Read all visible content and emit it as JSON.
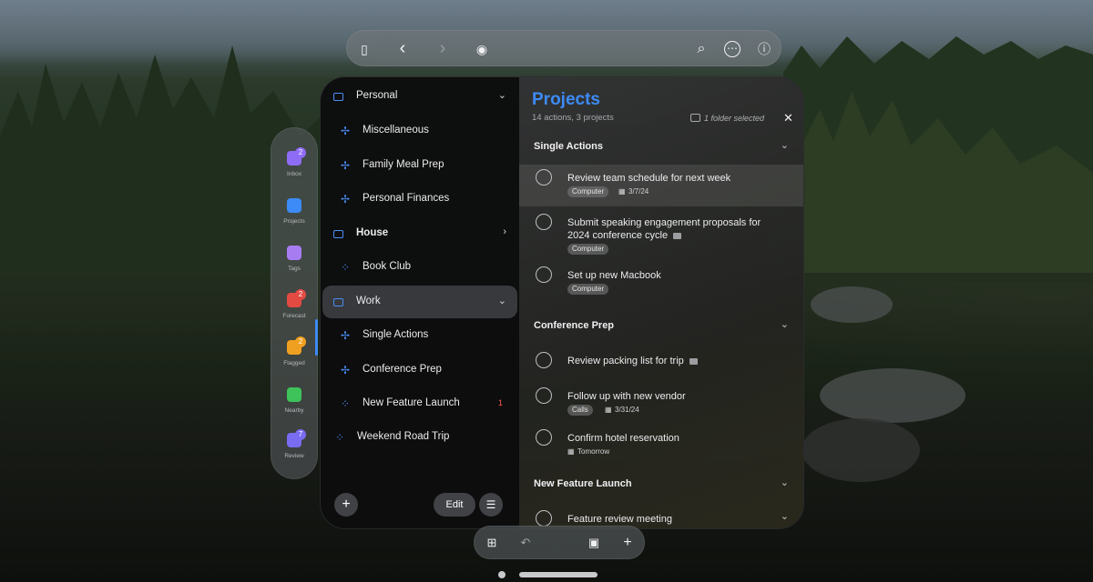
{
  "toolbar": {
    "buttons": [
      {
        "name": "sidebar-toggle-icon",
        "glyph": "▯"
      },
      {
        "name": "back-icon",
        "glyph": "‹"
      },
      {
        "name": "forward-icon",
        "glyph": "›"
      },
      {
        "name": "eye-icon",
        "glyph": "◉"
      },
      {
        "name": "search-icon",
        "glyph": "⌕"
      },
      {
        "name": "more-icon",
        "glyph": "⋯"
      },
      {
        "name": "info-icon",
        "glyph": "ⓘ"
      }
    ]
  },
  "tabs": [
    {
      "label": "Inbox",
      "badge": "2",
      "color": "#8e6cf5",
      "badge_color": "#8e6cf5"
    },
    {
      "label": "Projects",
      "badge": "",
      "color": "#3d8bf7",
      "badge_color": ""
    },
    {
      "label": "Tags",
      "badge": "",
      "color": "#a77cf0",
      "badge_color": ""
    },
    {
      "label": "Forecast",
      "badge": "2",
      "color": "#e24a42",
      "badge_color": "#e24a42"
    },
    {
      "label": "Flagged",
      "badge": "2",
      "color": "#f0a020",
      "badge_color": "#f0a020"
    },
    {
      "label": "Nearby",
      "badge": "",
      "color": "#3ec25a",
      "badge_color": ""
    },
    {
      "label": "Review",
      "badge": "7",
      "color": "#7a6cf0",
      "badge_color": "#7a6cf0"
    }
  ],
  "sidebar": {
    "items": [
      {
        "label": "Personal",
        "kind": "folder",
        "chevron": "⌄",
        "count": ""
      },
      {
        "label": "Miscellaneous",
        "kind": "project",
        "chevron": "",
        "count": ""
      },
      {
        "label": "Family Meal Prep",
        "kind": "project",
        "chevron": "",
        "count": ""
      },
      {
        "label": "Personal Finances",
        "kind": "project",
        "chevron": "",
        "count": ""
      },
      {
        "label": "House",
        "kind": "folder",
        "chevron": "›",
        "count": ""
      },
      {
        "label": "Book Club",
        "kind": "project-grid",
        "chevron": "",
        "count": ""
      },
      {
        "label": "Work",
        "kind": "folder",
        "chevron": "⌄",
        "count": ""
      },
      {
        "label": "Single Actions",
        "kind": "project",
        "chevron": "",
        "count": ""
      },
      {
        "label": "Conference Prep",
        "kind": "project",
        "chevron": "",
        "count": ""
      },
      {
        "label": "New Feature Launch",
        "kind": "project-grid",
        "chevron": "",
        "count": "1"
      },
      {
        "label": "Weekend Road Trip",
        "kind": "project-grid",
        "chevron": "",
        "count": ""
      }
    ],
    "add_label": "+",
    "edit_label": "Edit",
    "list_icon": "☰"
  },
  "content": {
    "title": "Projects",
    "subtitle": "14 actions, 3 projects",
    "selection": "1 folder selected",
    "close": "✕",
    "sections": [
      {
        "title": "Single Actions",
        "tasks": [
          {
            "title": "Review team schedule for next week",
            "tag": "Computer",
            "date": "3/7/24",
            "note": false
          },
          {
            "title": "Submit speaking engagement proposals for 2024 conference cycle",
            "tag": "Computer",
            "date": "",
            "note": true
          },
          {
            "title": "Set up new Macbook",
            "tag": "Computer",
            "date": "",
            "note": false
          }
        ]
      },
      {
        "title": "Conference Prep",
        "tasks": [
          {
            "title": "Review packing list for trip",
            "tag": "",
            "date": "",
            "note": true
          },
          {
            "title": "Follow up with new vendor",
            "tag": "Calls",
            "date": "3/31/24",
            "note": false
          },
          {
            "title": "Confirm hotel reservation",
            "tag": "",
            "date": "Tomorrow",
            "note": false
          }
        ]
      },
      {
        "title": "New Feature Launch",
        "tasks": [
          {
            "title": "Feature review meeting",
            "tag": "",
            "date": "",
            "note": false
          }
        ]
      }
    ]
  },
  "ornament": {
    "buttons": [
      {
        "name": "quick-entry-icon",
        "glyph": "⊞"
      },
      {
        "name": "undo-icon",
        "glyph": "↶"
      },
      {
        "name": "inbox-tray-icon",
        "glyph": "▣"
      },
      {
        "name": "add-icon",
        "glyph": "+"
      }
    ]
  }
}
